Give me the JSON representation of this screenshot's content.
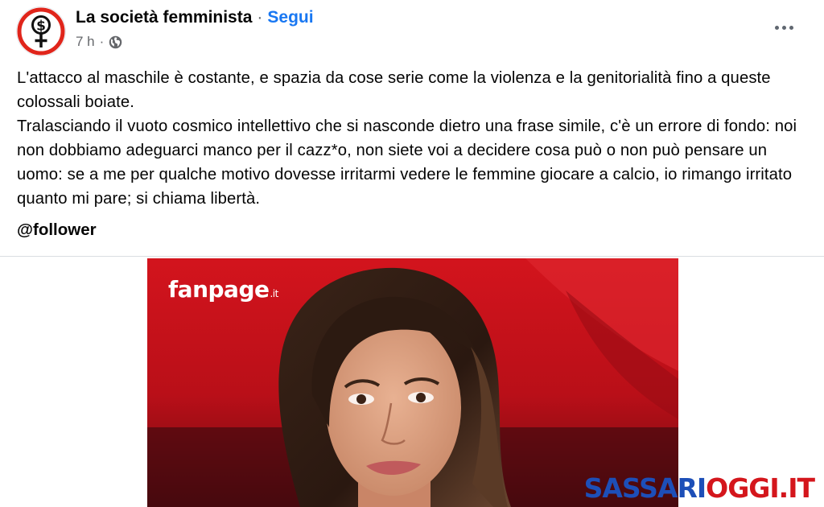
{
  "header": {
    "page_name": "La società femminista",
    "separator": "·",
    "follow_label": "Segui",
    "time": "7 h",
    "meta_separator": "·",
    "audience_icon": "globe-icon",
    "more_icon": "more-horizontal-icon"
  },
  "avatar": {
    "icon": "dollar-venus-symbol-icon",
    "ring_color": "#e0251b"
  },
  "post": {
    "paragraph_1": "L'attacco al maschile è costante, e spazia da cose serie come la violenza e la genitorialità fino a queste colossali boiate.",
    "paragraph_2": "Tralasciando il vuoto cosmico intellettivo che si nasconde dietro una frase simile, c'è un errore di fondo: noi non dobbiamo adeguarci manco per il cazz*o, non siete voi a decidere cosa può o non può pensare un uomo: se a me per qualche motivo dovesse irritarmi vedere le femmine giocare a calcio, io rimango irritato quanto mi pare; si chiama libertà.",
    "mention": "@follower"
  },
  "image": {
    "logo_text": "fanpage",
    "logo_tld": ".it",
    "watermark_part_1": "SASSARI",
    "watermark_part_2": "OGGI.IT",
    "colors": {
      "background": "#c1121a",
      "watermark_blue": "#1d4fb8",
      "watermark_red": "#d4161c"
    }
  },
  "colors": {
    "link": "#1877f2",
    "secondary_text": "#65676b",
    "primary_text": "#050505"
  }
}
